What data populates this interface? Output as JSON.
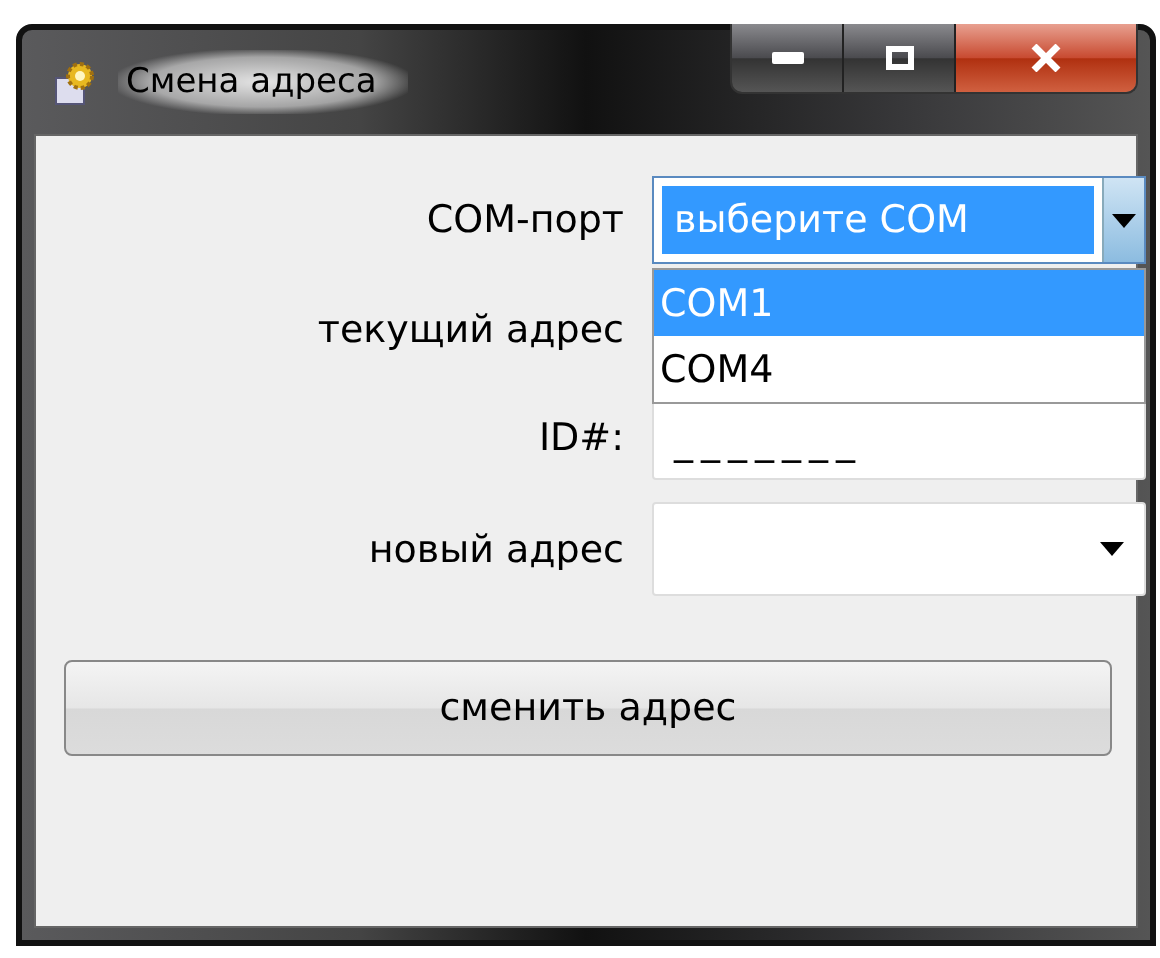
{
  "window": {
    "title": "Смена адреса"
  },
  "form": {
    "com_port": {
      "label": "COM-порт",
      "value": "выберите COM",
      "focused": true,
      "expanded": true,
      "options": [
        {
          "label": "COM1",
          "selected": true
        },
        {
          "label": "COM4",
          "selected": false
        }
      ]
    },
    "current_address": {
      "label": "текущий адрес"
    },
    "id": {
      "label": "ID#:",
      "value": "_______"
    },
    "new_address": {
      "label": "новый адрес"
    }
  },
  "buttons": [
    "сменить адрес"
  ]
}
